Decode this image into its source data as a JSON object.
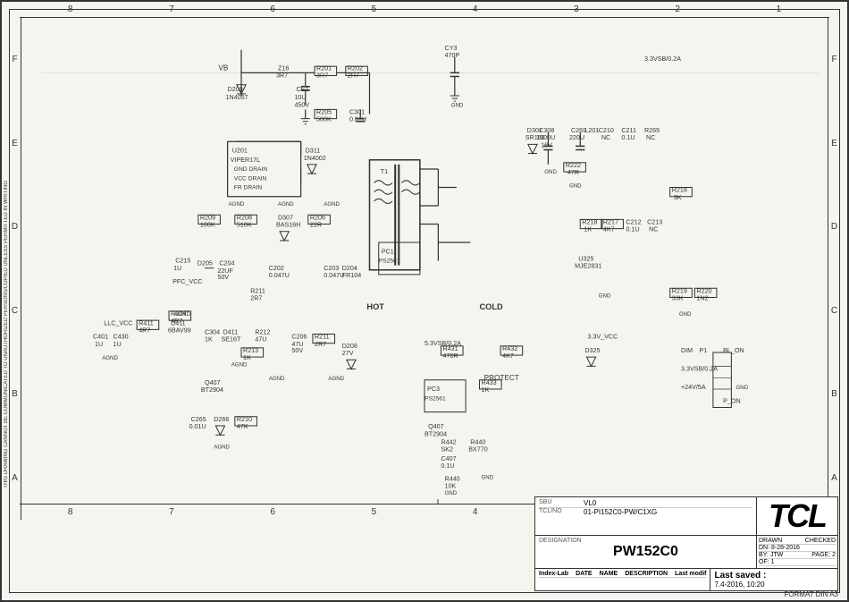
{
  "schematic": {
    "title": "TCL",
    "designation": "PW152C0",
    "sbu": "VL0",
    "tclno": "01-PI152C0-PW/C1XG",
    "format": "FORMAT DIN A3",
    "last_saved": "Last saved :",
    "last_saved_date": "7.4-2016, 10:20",
    "drawn_label": "DRAWN",
    "checked_label": "CHECKED",
    "drawn_date": "DN: 8-28-2016",
    "drawn_name": "BY: JTW",
    "page_label": "PAGE: 2",
    "of_label": "OF: 1",
    "index_lab_header": [
      "Index-Lab",
      "DATE",
      "NAME",
      "DESCRIPTION",
      "Last modif"
    ],
    "hot_label": "HOT",
    "cold_label": "COLD",
    "vertical_text": "THIS DRAWING CANNOT BE COMMUNICATED TO UNAUTHORIZED PERSONS/COPIED UNLESS PERMITTED IN WRITING",
    "col_markers": [
      "8",
      "7",
      "6",
      "5",
      "4",
      "3",
      "2",
      "1"
    ],
    "row_markers": [
      "F",
      "E",
      "D",
      "C",
      "B",
      "A"
    ],
    "sbu_label": "SBU",
    "tclno_label": "TCL/NO",
    "designation_label": "DESIGNATION"
  }
}
